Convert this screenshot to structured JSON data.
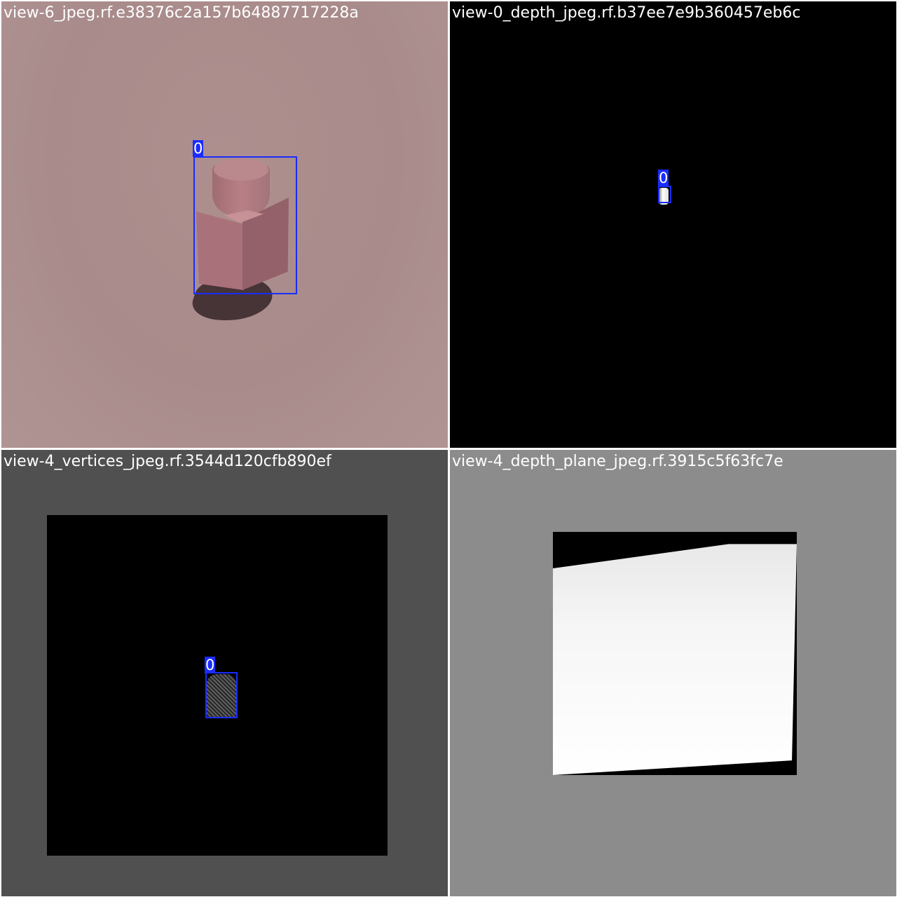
{
  "tiles": [
    {
      "title": "view-6_jpeg.rf.e38376c2a157b64887717228a",
      "box_label": "0",
      "background": "#a88a88"
    },
    {
      "title": "view-0_depth_jpeg.rf.b37ee7e9b360457eb6c",
      "box_label": "0",
      "background": "#000000"
    },
    {
      "title": "view-4_vertices_jpeg.rf.3544d120cfb890ef",
      "box_label": "0",
      "background": "#505050"
    },
    {
      "title": "view-4_depth_plane_jpeg.rf.3915c5f63fc7e",
      "background": "#8c8c8c"
    }
  ],
  "colors": {
    "bbox": "#1a2cff",
    "title_text": "#ffffff"
  }
}
